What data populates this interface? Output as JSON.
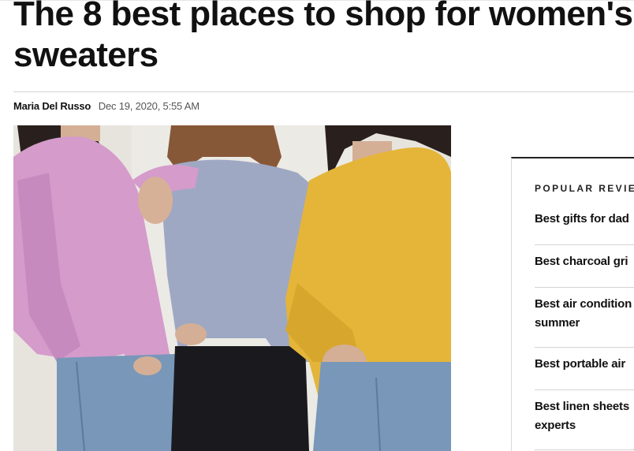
{
  "article": {
    "headline_line1": "The 8 best places to shop for women's",
    "headline_line2": "sweaters",
    "author": "Maria Del Russo",
    "date": "Dec 19, 2020, 5:55 AM"
  },
  "colors": {
    "pink_sweater": "#d99fd0",
    "blue_sweater": "#a3acc7",
    "yellow_sweater": "#e9b93a",
    "jeans": "#7b9bbd",
    "black_pants": "#1b1b1f",
    "wall": "#ece9e3"
  },
  "sidebar": {
    "heading": "POPULAR REVIE",
    "items": [
      {
        "line1": "Best gifts for dad",
        "line2": ""
      },
      {
        "line1": "Best charcoal gri",
        "line2": ""
      },
      {
        "line1": "Best air condition",
        "line2": "summer"
      },
      {
        "line1": "Best portable air",
        "line2": ""
      },
      {
        "line1": "Best linen sheets",
        "line2": "experts"
      }
    ]
  }
}
